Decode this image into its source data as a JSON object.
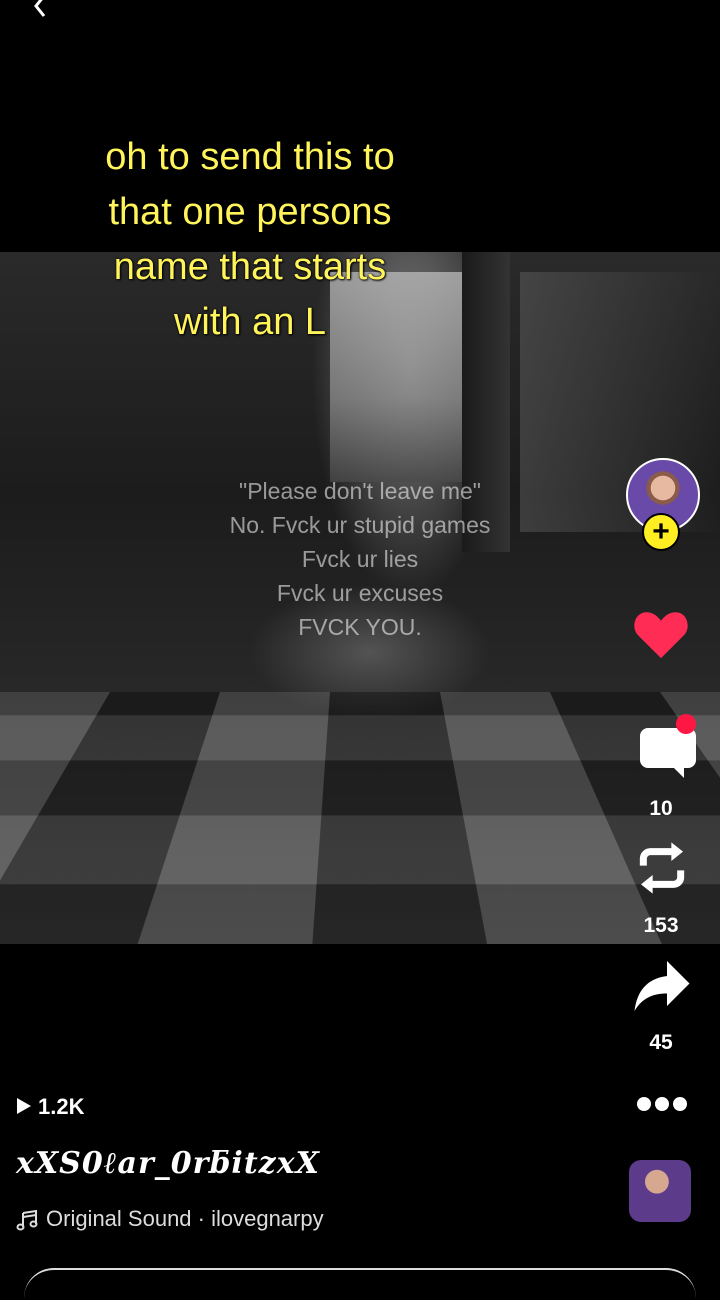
{
  "caption": [
    "oh to send this to",
    "that one persons",
    "name that starts",
    "with an L"
  ],
  "video_text": [
    "\"Please don't leave me\"",
    "No. Fvck ur stupid games",
    "Fvck ur lies",
    "Fvck ur excuses",
    "FVCK YOU."
  ],
  "actions": {
    "comments_count": "10",
    "reposts_count": "153",
    "shares_count": "45"
  },
  "views": "1.2K",
  "username": "xXS0ℓar_0rƃitzxX",
  "sound": "Original Sound · ilovegnarpy",
  "colors": {
    "like": "#ff2c55",
    "follow": "#ffee22",
    "caption": "#fff45a",
    "notification": "#ff1744"
  },
  "icons": [
    "back-icon",
    "heart-icon",
    "comment-icon",
    "repost-icon",
    "share-icon",
    "more-icon",
    "music-note-icon",
    "play-icon"
  ]
}
